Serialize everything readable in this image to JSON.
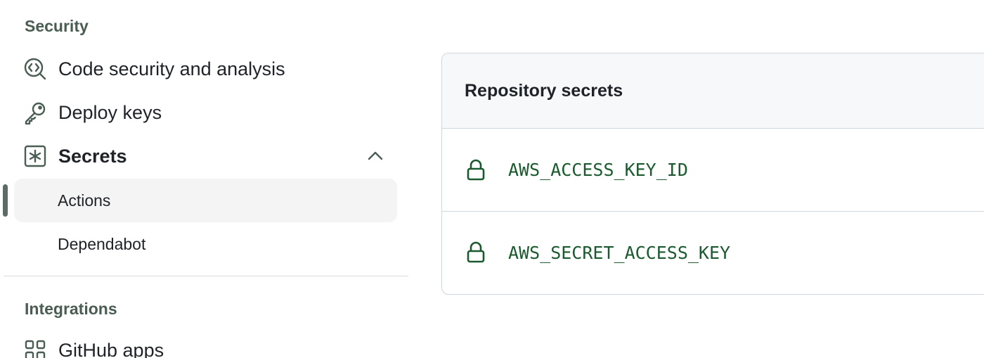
{
  "sidebar": {
    "security_heading": "Security",
    "items": [
      {
        "label": "Code security and analysis",
        "icon": "codescan-icon"
      },
      {
        "label": "Deploy keys",
        "icon": "key-icon"
      },
      {
        "label": "Secrets",
        "icon": "asterisk-icon",
        "expanded": true
      }
    ],
    "secrets_subitems": [
      {
        "label": "Actions",
        "active": true
      },
      {
        "label": "Dependabot",
        "active": false
      }
    ],
    "integrations_heading": "Integrations",
    "integrations_items": [
      {
        "label": "GitHub apps",
        "icon": "apps-icon"
      }
    ]
  },
  "secrets_panel": {
    "title": "Repository secrets",
    "secrets": [
      {
        "name": "AWS_ACCESS_KEY_ID",
        "icon": "lock-icon"
      },
      {
        "name": "AWS_SECRET_ACCESS_KEY",
        "icon": "lock-icon"
      }
    ]
  },
  "colors": {
    "secret_name": "#1a5a2e",
    "heading": "#4a5d53",
    "active_bg": "#f3f4f3",
    "border": "#d0d7de"
  }
}
